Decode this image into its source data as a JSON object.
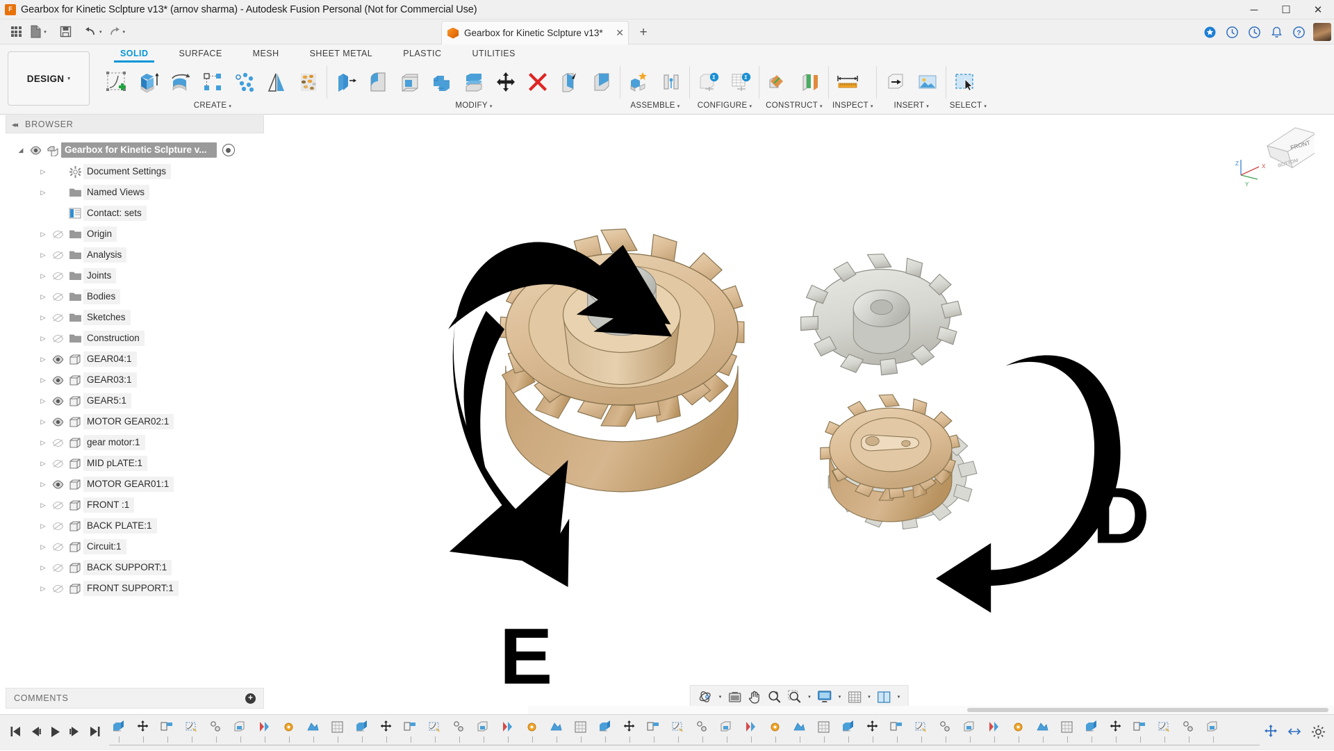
{
  "window": {
    "title": "Gearbox for Kinetic Sclpture v13* (arnov sharma) - Autodesk Fusion Personal (Not for Commercial Use)",
    "minimize_label": "─",
    "maximize_label": "☐",
    "close_label": "✕",
    "app_icon_glyph": "F"
  },
  "quick_access": {
    "apps_grid_icon": "grid-icon",
    "new_file_label": "new-file-icon",
    "save_label": "save-icon",
    "undo_label": "undo-icon",
    "redo_label": "redo-icon",
    "caret": "▾"
  },
  "tabs": {
    "document_tab": {
      "label": "Gearbox for Kinetic Sclpture v13*",
      "close_glyph": "✕"
    },
    "new_tab_glyph": "+"
  },
  "right_cluster": {
    "items": [
      {
        "name": "extensions-icon",
        "glyph": "✦"
      },
      {
        "name": "help-clock-icon",
        "glyph": "◴"
      },
      {
        "name": "recent-icon",
        "glyph": "◷"
      },
      {
        "name": "notifications-bell-icon",
        "glyph": "ὑ4"
      },
      {
        "name": "help-icon",
        "glyph": "?"
      }
    ]
  },
  "ribbon": {
    "design_dropdown": "DESIGN",
    "workspace_tabs": [
      {
        "label": "SOLID",
        "active": true
      },
      {
        "label": "SURFACE",
        "active": false
      },
      {
        "label": "MESH",
        "active": false
      },
      {
        "label": "SHEET METAL",
        "active": false
      },
      {
        "label": "PLASTIC",
        "active": false
      },
      {
        "label": "UTILITIES",
        "active": false
      }
    ],
    "groups": [
      {
        "label": "CREATE",
        "has_caret": true,
        "tools": [
          "create-sketch-icon",
          "extrude-icon",
          "revolve-icon",
          "rectangular-pattern-icon",
          "circular-pattern-icon",
          "mirror-icon",
          "thread-icon"
        ]
      },
      {
        "label": "MODIFY",
        "has_caret": true,
        "tools": [
          "press-pull-icon",
          "fillet-icon",
          "shell-icon",
          "combine-icon",
          "offset-face-icon",
          "move-copy-icon",
          "delete-icon",
          "split-face-icon",
          "draft-icon"
        ]
      },
      {
        "label": "ASSEMBLE",
        "has_caret": true,
        "tools": [
          "new-component-icon",
          "joint-icon"
        ]
      },
      {
        "label": "CONFIGURE",
        "has_caret": true,
        "tools": [
          "configure-design-icon",
          "configure-table-icon"
        ]
      },
      {
        "label": "CONSTRUCT",
        "has_caret": true,
        "tools": [
          "offset-plane-icon",
          "plane-along-path-icon"
        ]
      },
      {
        "label": "INSPECT",
        "has_caret": true,
        "tools": [
          "measure-icon"
        ]
      },
      {
        "label": "INSERT",
        "has_caret": true,
        "tools": [
          "insert-derive-icon",
          "insert-canvas-icon"
        ]
      },
      {
        "label": "SELECT",
        "has_caret": true,
        "tools": [
          "select-window-icon"
        ]
      }
    ]
  },
  "browser": {
    "header_title": "BROWSER",
    "collapse_glyph": "◂◂",
    "root": {
      "label": "Gearbox for Kinetic Sclpture v...",
      "visible": true,
      "expanded": true
    },
    "items": [
      {
        "label": "Document Settings",
        "icon": "gear-icon",
        "visible": null,
        "indent": 1
      },
      {
        "label": "Named Views",
        "icon": "folder-icon",
        "visible": null,
        "indent": 1
      },
      {
        "label": "Contact: sets",
        "icon": "contact-sets-icon",
        "visible": null,
        "indent": 1,
        "no_arrow": true
      },
      {
        "label": "Origin",
        "icon": "folder-icon",
        "visible": false,
        "indent": 1
      },
      {
        "label": "Analysis",
        "icon": "folder-icon",
        "visible": false,
        "indent": 1
      },
      {
        "label": "Joints",
        "icon": "folder-icon",
        "visible": false,
        "indent": 1
      },
      {
        "label": "Bodies",
        "icon": "folder-icon",
        "visible": false,
        "indent": 1
      },
      {
        "label": "Sketches",
        "icon": "folder-icon",
        "visible": false,
        "indent": 1
      },
      {
        "label": "Construction",
        "icon": "folder-icon",
        "visible": false,
        "indent": 1
      },
      {
        "label": "GEAR04:1",
        "icon": "component-icon",
        "visible": true,
        "indent": 1
      },
      {
        "label": "GEAR03:1",
        "icon": "component-icon",
        "visible": true,
        "indent": 1
      },
      {
        "label": "GEAR5:1",
        "icon": "component-icon",
        "visible": true,
        "indent": 1
      },
      {
        "label": "MOTOR GEAR02:1",
        "icon": "component-icon",
        "visible": true,
        "indent": 1
      },
      {
        "label": "gear motor:1",
        "icon": "component-icon",
        "visible": false,
        "indent": 1
      },
      {
        "label": "MID pLATE:1",
        "icon": "component-icon",
        "visible": false,
        "indent": 1
      },
      {
        "label": "MOTOR GEAR01:1",
        "icon": "component-icon",
        "visible": true,
        "indent": 1
      },
      {
        "label": "FRONT :1",
        "icon": "component-icon",
        "visible": false,
        "indent": 1
      },
      {
        "label": "BACK PLATE:1",
        "icon": "component-icon",
        "visible": false,
        "indent": 1
      },
      {
        "label": "Circuit:1",
        "icon": "component-icon",
        "visible": false,
        "indent": 1
      },
      {
        "label": "BACK SUPPORT:1",
        "icon": "component-icon",
        "visible": false,
        "indent": 1
      },
      {
        "label": "FRONT SUPPORT:1",
        "icon": "component-icon",
        "visible": false,
        "indent": 1
      }
    ],
    "comments": {
      "title": "COMMENTS",
      "add_glyph": "+"
    }
  },
  "canvas": {
    "annotations": [
      {
        "name": "letter-e",
        "text": "E"
      },
      {
        "name": "letter-d",
        "text": "D"
      }
    ],
    "model_colors": {
      "gear_tan": "#dfc19a",
      "gear_tan_dark": "#c4a278",
      "gear_tan_light": "#e8d3b4",
      "gear_grey": "#d9d9d4",
      "gear_grey_dark": "#bcbcb6",
      "hub_grey": "#cfcfcf",
      "outline": "#6d6352",
      "arrow_black": "#000000"
    },
    "viewcube": {
      "front_label": "FRONT",
      "bottom_label": "BOTTOM",
      "axis_x": "X",
      "axis_y": "Y",
      "axis_z": "Z"
    }
  },
  "navbar": {
    "items": [
      {
        "name": "orbit-icon",
        "caret": true
      },
      {
        "name": "look-at-icon",
        "caret": false
      },
      {
        "name": "pan-icon",
        "caret": false
      },
      {
        "name": "zoom-icon",
        "caret": false
      },
      {
        "name": "zoom-window-icon",
        "caret": true
      },
      {
        "name": "display-settings-icon",
        "caret": true
      },
      {
        "name": "grid-snaps-icon",
        "caret": true
      },
      {
        "name": "viewports-icon",
        "caret": true
      }
    ]
  },
  "timeline": {
    "playback": [
      {
        "name": "jump-to-beginning-icon",
        "glyph": "⏮"
      },
      {
        "name": "step-back-icon",
        "glyph": "⏴"
      },
      {
        "name": "play-icon",
        "glyph": "▶"
      },
      {
        "name": "step-forward-icon",
        "glyph": "⏵"
      },
      {
        "name": "jump-to-end-icon",
        "glyph": "⏭"
      }
    ],
    "feature_count": 46,
    "end_tools": [
      {
        "name": "timeline-move-icon"
      },
      {
        "name": "timeline-expand-icon"
      },
      {
        "name": "timeline-settings-gear-icon"
      }
    ]
  }
}
